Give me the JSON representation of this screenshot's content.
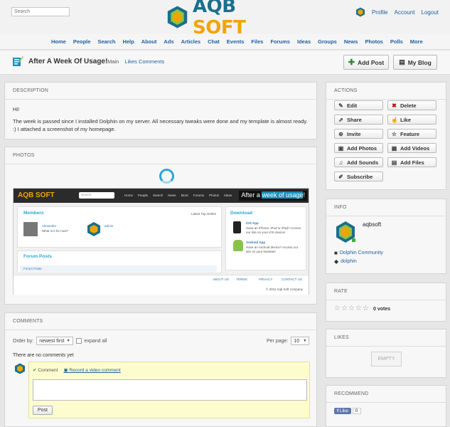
{
  "header": {
    "search_placeholder": "Search",
    "logo_part1": "AQB",
    "logo_part2": "SOFT",
    "user_links": [
      "Profile",
      "Account",
      "Logout"
    ]
  },
  "nav": [
    "Home",
    "People",
    "Search",
    "Help",
    "About",
    "Ads",
    "Articles",
    "Chat",
    "Events",
    "Files",
    "Forums",
    "Ideas",
    "Groups",
    "News",
    "Photos",
    "Polls",
    "More"
  ],
  "page": {
    "title": "After A Week Of Usage!",
    "tab_main": "Main",
    "tab_likes": "Likes",
    "tab_comments": "Comments",
    "add_post": "Add Post",
    "my_blog": "My Blog"
  },
  "description": {
    "heading": "DESCRIPTION",
    "greeting": "Hi!",
    "text": "The week is passed since I installed Dolphin on my server. All necessary tweaks were done and my template is almost ready. :) I attached a screenshot of my homepage."
  },
  "photos": {
    "heading": "PHOTOS",
    "shot": {
      "logo": "AQB SOFT",
      "search": "Search",
      "nav": [
        "Home",
        "People",
        "Search",
        "News",
        "More",
        "Forums",
        "Photos",
        "Ideas"
      ],
      "caption_pre": "After a ",
      "caption_hl": "week of usage",
      "caption_post": "!",
      "members": "Members",
      "members_tabs": "Latest  Top  Online",
      "member1": "Alexander",
      "member1_sub": "What is it for now?",
      "member2": "admin",
      "download": "Download",
      "ios_title": "iOS App",
      "ios_text1": "Have an iPhone, iPod or iPad? Access",
      "ios_text2": "our site on your iOS device!",
      "android_title": "Android App",
      "android_text1": "Have an Android device? Access our",
      "android_text2": "site on your handset!",
      "forum_posts": "Forum Posts",
      "forum_sub": "Forum Posts",
      "footer_links": [
        "ABOUT US",
        "TERMS",
        "PRIVACY",
        "CONTACT US"
      ],
      "copyright": "© 2011 Aqb Soft company"
    }
  },
  "comments": {
    "heading": "COMMENTS",
    "order_by": "Order by:",
    "order_value": "newest first",
    "expand_all": "expand all",
    "per_page": "Per page:",
    "per_page_value": "10",
    "empty": "There are no comments yet",
    "tab_comment": "Comment",
    "tab_video": "Record a video comment",
    "post": "Post"
  },
  "actions": {
    "heading": "ACTIONS",
    "items": [
      "Edit",
      "Delete",
      "Share",
      "Like",
      "Invite",
      "Feature",
      "Add Photos",
      "Add Videos",
      "Add Sounds",
      "Add Files",
      "Subscribe"
    ]
  },
  "info": {
    "heading": "INFO",
    "author": "aqbsoft",
    "category": "Dolphin Community",
    "tag": "dolphin"
  },
  "rate": {
    "heading": "RATE",
    "votes": "0 votes",
    "rating": 0,
    "max": 5
  },
  "likes": {
    "heading": "LIKES",
    "empty": "EMPTY"
  },
  "recommend": {
    "heading": "RECOMMEND",
    "like": "Like",
    "count": "0"
  },
  "colors": {
    "link": "#1f5f9e",
    "accent_teal": "#1b6e8c",
    "accent_orange": "#f0a500",
    "comment_bg": "#fdfccf"
  }
}
